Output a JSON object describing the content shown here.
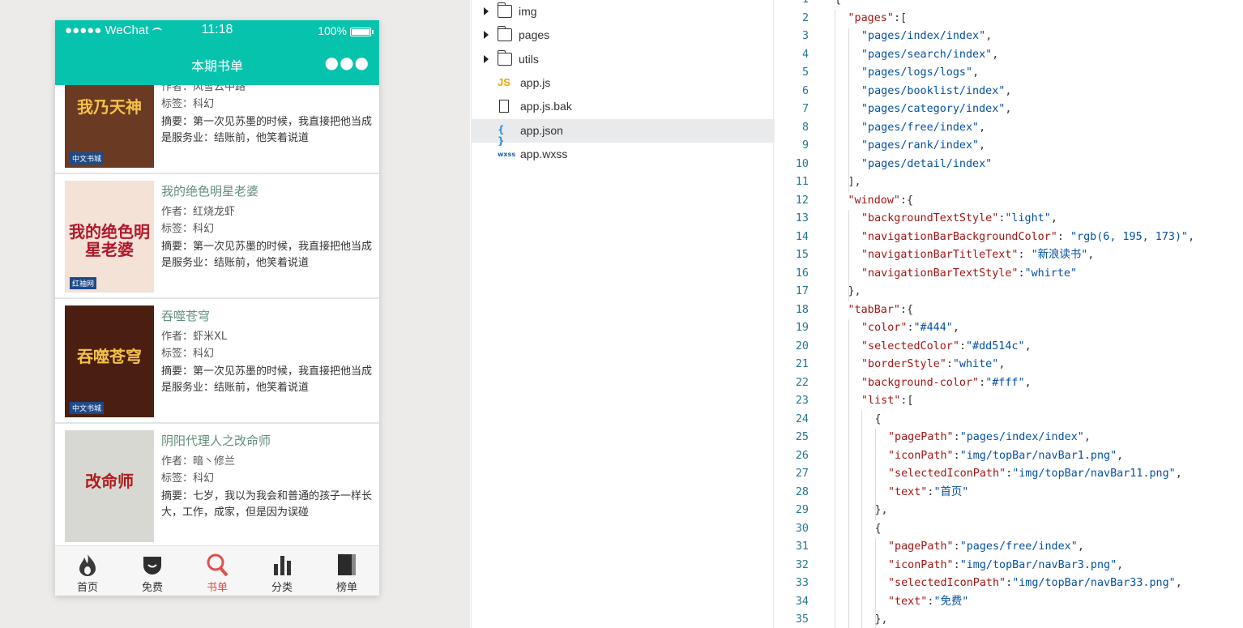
{
  "simulator": {
    "status": {
      "carrier": "●●●●● WeChat",
      "time": "11:18",
      "battery": "100%"
    },
    "nav": {
      "title": "本期书单",
      "more": "●●●"
    },
    "books": [
      {
        "title": "",
        "cover_text": "我乃天神",
        "author": "作者：风雪云中路",
        "tag": "标签：科幻",
        "summary": "摘要：第一次见苏墨的时候，我直接把他当成是服务业：结账前，他笑着说道",
        "cover_bg": "#6b3a22",
        "brand": "中文书城"
      },
      {
        "title": "我的绝色明星老婆",
        "cover_text": "我的绝色明星老婆",
        "author": "作者：红烧龙虾",
        "tag": "标签：科幻",
        "summary": "摘要：第一次见苏墨的时候，我直接把他当成是服务业：结账前，他笑着说道",
        "cover_bg": "#f4e2d6",
        "brand": "红袖网"
      },
      {
        "title": "吞噬苍穹",
        "cover_text": "吞噬苍穹",
        "author": "作者：虾米XL",
        "tag": "标签：科幻",
        "summary": "摘要：第一次见苏墨的时候，我直接把他当成是服务业：结账前，他笑着说道",
        "cover_bg": "#4a1f12",
        "brand": "中文书城"
      },
      {
        "title": "阴阳代理人之改命师",
        "cover_text": "改命师",
        "author": "作者：暗丶修兰",
        "tag": "标签：科幻",
        "summary": "摘要：七岁，我以为我会和普通的孩子一样长大，工作，成家，但是因为误碰",
        "cover_bg": "#d8d8d2",
        "brand": ""
      }
    ],
    "tabs": [
      {
        "label": "首页",
        "icon": "flame-icon",
        "selected": false
      },
      {
        "label": "免费",
        "icon": "smile-bag-icon",
        "selected": false
      },
      {
        "label": "书单",
        "icon": "magnifier-icon",
        "selected": true
      },
      {
        "label": "分类",
        "icon": "bar-chart-icon",
        "selected": false
      },
      {
        "label": "榜单",
        "icon": "book-icon",
        "selected": false
      }
    ],
    "colors": {
      "nav": "#06c3ad",
      "tab_selected": "#dd514c",
      "tab_normal": "#333333"
    }
  },
  "tree": {
    "items": [
      {
        "label": "img",
        "type": "folder",
        "icon": "folder-icon"
      },
      {
        "label": "pages",
        "type": "folder",
        "icon": "folder-icon"
      },
      {
        "label": "utils",
        "type": "folder",
        "icon": "folder-icon"
      },
      {
        "label": "app.js",
        "type": "js",
        "icon": "js-file-icon",
        "badge": "JS"
      },
      {
        "label": "app.js.bak",
        "type": "file",
        "icon": "file-icon"
      },
      {
        "label": "app.json",
        "type": "json",
        "icon": "json-file-icon",
        "badge": "{ }",
        "selected": true
      },
      {
        "label": "app.wxss",
        "type": "wxss",
        "icon": "wxss-file-icon",
        "badge": "wxss"
      }
    ]
  },
  "editor": {
    "first_line": 1,
    "lines": [
      [
        [
          "p",
          "{"
        ]
      ],
      [
        [
          "k",
          "\"pages\""
        ],
        [
          "p",
          ":["
        ]
      ],
      [
        [
          "s",
          "\"pages/index/index\""
        ],
        [
          "p",
          ","
        ]
      ],
      [
        [
          "s",
          "\"pages/search/index\""
        ],
        [
          "p",
          ","
        ]
      ],
      [
        [
          "s",
          "\"pages/logs/logs\""
        ],
        [
          "p",
          ","
        ]
      ],
      [
        [
          "s",
          "\"pages/booklist/index\""
        ],
        [
          "p",
          ","
        ]
      ],
      [
        [
          "s",
          "\"pages/category/index\""
        ],
        [
          "p",
          ","
        ]
      ],
      [
        [
          "s",
          "\"pages/free/index\""
        ],
        [
          "p",
          ","
        ]
      ],
      [
        [
          "s",
          "\"pages/rank/index\""
        ],
        [
          "p",
          ","
        ]
      ],
      [
        [
          "s",
          "\"pages/detail/index\""
        ]
      ],
      [
        [
          "p",
          "],"
        ]
      ],
      [
        [
          "k",
          "\"window\""
        ],
        [
          "p",
          ":{"
        ]
      ],
      [
        [
          "k",
          "\"backgroundTextStyle\""
        ],
        [
          "p",
          ":"
        ],
        [
          "s",
          "\"light\""
        ],
        [
          "p",
          ","
        ]
      ],
      [
        [
          "k",
          "\"navigationBarBackgroundColor\""
        ],
        [
          "p",
          ": "
        ],
        [
          "s",
          "\"rgb(6, 195, 173)\""
        ],
        [
          "p",
          ","
        ]
      ],
      [
        [
          "k",
          "\"navigationBarTitleText\""
        ],
        [
          "p",
          ": "
        ],
        [
          "s",
          "\"新浪读书\""
        ],
        [
          "p",
          ","
        ]
      ],
      [
        [
          "k",
          "\"navigationBarTextStyle\""
        ],
        [
          "p",
          ":"
        ],
        [
          "s",
          "\"whirte\""
        ]
      ],
      [
        [
          "p",
          "},"
        ]
      ],
      [
        [
          "k",
          "\"tabBar\""
        ],
        [
          "p",
          ":{"
        ]
      ],
      [
        [
          "k",
          "\"color\""
        ],
        [
          "p",
          ":"
        ],
        [
          "s",
          "\"#444\""
        ],
        [
          "p",
          ","
        ]
      ],
      [
        [
          "k",
          "\"selectedColor\""
        ],
        [
          "p",
          ":"
        ],
        [
          "s",
          "\"#dd514c\""
        ],
        [
          "p",
          ","
        ]
      ],
      [
        [
          "k",
          "\"borderStyle\""
        ],
        [
          "p",
          ":"
        ],
        [
          "s",
          "\"white\""
        ],
        [
          "p",
          ","
        ]
      ],
      [
        [
          "k",
          "\"background-color\""
        ],
        [
          "p",
          ":"
        ],
        [
          "s",
          "\"#fff\""
        ],
        [
          "p",
          ","
        ]
      ],
      [
        [
          "k",
          "\"list\""
        ],
        [
          "p",
          ":["
        ]
      ],
      [
        [
          "p",
          "{"
        ]
      ],
      [
        [
          "k",
          "\"pagePath\""
        ],
        [
          "p",
          ":"
        ],
        [
          "s",
          "\"pages/index/index\""
        ],
        [
          "p",
          ","
        ]
      ],
      [
        [
          "k",
          "\"iconPath\""
        ],
        [
          "p",
          ":"
        ],
        [
          "s",
          "\"img/topBar/navBar1.png\""
        ],
        [
          "p",
          ","
        ]
      ],
      [
        [
          "k",
          "\"selectedIconPath\""
        ],
        [
          "p",
          ":"
        ],
        [
          "s",
          "\"img/topBar/navBar11.png\""
        ],
        [
          "p",
          ","
        ]
      ],
      [
        [
          "k",
          "\"text\""
        ],
        [
          "p",
          ":"
        ],
        [
          "s",
          "\"首页\""
        ]
      ],
      [
        [
          "p",
          "},"
        ]
      ],
      [
        [
          "p",
          "{"
        ]
      ],
      [
        [
          "k",
          "\"pagePath\""
        ],
        [
          "p",
          ":"
        ],
        [
          "s",
          "\"pages/free/index\""
        ],
        [
          "p",
          ","
        ]
      ],
      [
        [
          "k",
          "\"iconPath\""
        ],
        [
          "p",
          ":"
        ],
        [
          "s",
          "\"img/topBar/navBar3.png\""
        ],
        [
          "p",
          ","
        ]
      ],
      [
        [
          "k",
          "\"selectedIconPath\""
        ],
        [
          "p",
          ":"
        ],
        [
          "s",
          "\"img/topBar/navBar33.png\""
        ],
        [
          "p",
          ","
        ]
      ],
      [
        [
          "k",
          "\"text\""
        ],
        [
          "p",
          ":"
        ],
        [
          "s",
          "\"免费\""
        ]
      ],
      [
        [
          "p",
          "},"
        ]
      ]
    ]
  }
}
